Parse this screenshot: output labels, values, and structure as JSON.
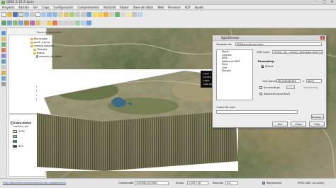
{
  "window": {
    "title": "QGIS 2.12.2-Lyon",
    "min": "–",
    "max": "□",
    "close": "✕"
  },
  "menubar": [
    "Proyecto",
    "Edición",
    "Ver",
    "Capa",
    "Configuración",
    "Complementos",
    "Vectorial",
    "Ráster",
    "Base de datos",
    "Web",
    "Procesos",
    "SCP",
    "Ayuda"
  ],
  "browser_panel": {
    "title": "Panel de explorador",
    "items": [
      "Municipios",
      "perfil_suelos",
      "rambra Bascala",
      "Tiascale",
      "Basco",
      "corsario_de_datos"
    ],
    "short_items": [
      "red",
      "red",
      "red",
      "red"
    ]
  },
  "layers_panel": {
    "group": "Capa Activa",
    "layer": "canelcn_we",
    "legend": [
      {
        "value": "1290",
        "color": "#f2e2c8"
      },
      {
        "value": "",
        "color": "#8fc9b4"
      },
      {
        "value": "",
        "color": "#3f8a7a"
      },
      {
        "value": "630",
        "color": "#1d4f4a"
      }
    ]
  },
  "view3d_menu": [
    "Layer",
    "Control Files",
    "Flight",
    "View Options"
  ],
  "dialog": {
    "title": "Qgis2threejs",
    "template_label": "Template file",
    "template_value": "3DViewer(dat-gui).html",
    "list_items": [
      "World",
      "Controls",
      "DEM",
      "Additional DEM",
      "Point",
      "Line",
      "Polygon"
    ],
    "dem_layer_label": "DEM Layer",
    "dem_layer_value": "canelcn_ws... canelcn_workspace-canel.1.c3",
    "resampling_label": "Resampling",
    "simple_label": "Simple",
    "grid_spacing_label": "Grid spacing",
    "grid_x_value": "68.2246465326",
    "grid_y_value": "68.03",
    "surroundings_label": "Surroundings",
    "roughening_label": "Roughening",
    "advanced_label": "Advanced (quad tree)",
    "output_label": "Output file path",
    "browse_label": "Browse...",
    "run_label": "Run",
    "close_label": "Close",
    "help_label": "Help"
  },
  "statusbar": {
    "link": "http://descrinter.ea/actualizacion-de-complemento",
    "coordinate_label": "Coordenada",
    "coordinate_value": "-693086,4213560",
    "scale_label": "Escala",
    "scale_value": "1:265,156",
    "rotation_label": "Rotación",
    "rotation_value": "0.0",
    "render_label": "Representar",
    "crs_label": "EPSG:3857 (al vuelo)"
  }
}
